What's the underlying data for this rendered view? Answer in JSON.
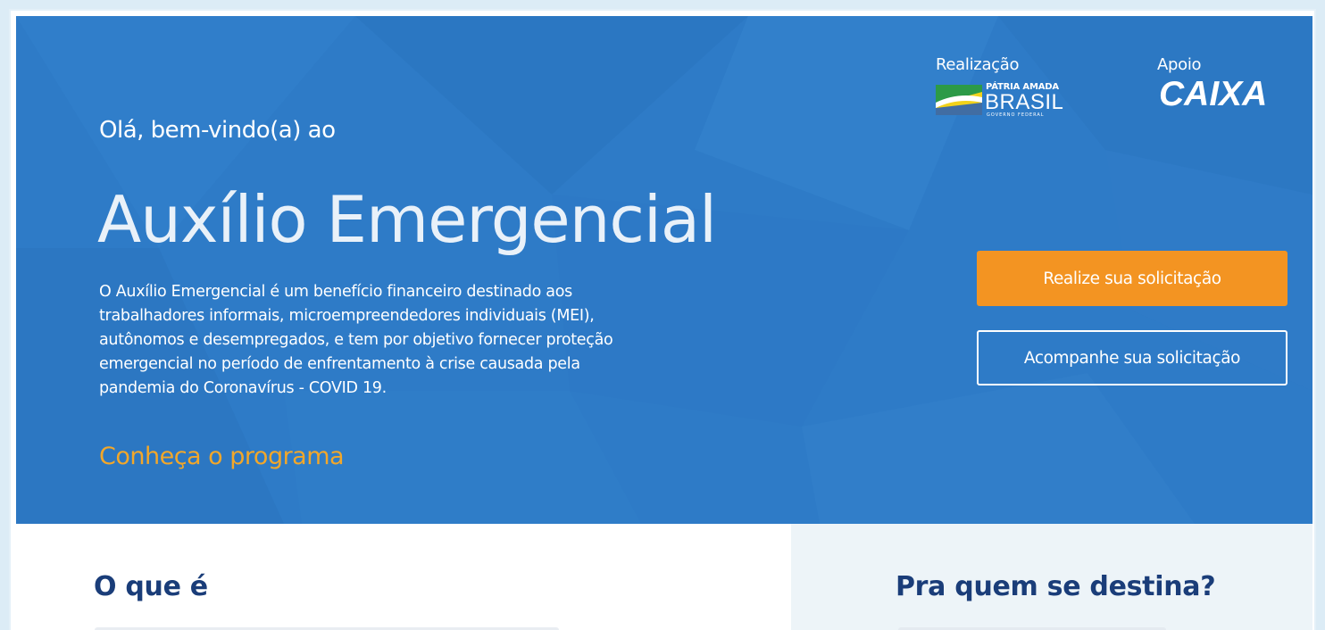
{
  "hero": {
    "greeting": "Olá, bem-vindo(a) ao",
    "title": "Auxílio Emergencial",
    "description": "O Auxílio Emergencial é um benefício financeiro destinado aos trabalhadores informais, microempreendedores individuais (MEI), autônomos e desempregados, e tem por objetivo fornecer proteção emergencial no período de enfrentamento à crise causada pela pandemia do Coronavírus - COVID 19.",
    "know_link": "Conheça o programa"
  },
  "partners": {
    "realizacao_label": "Realização",
    "brasil_small": "PÁTRIA AMADA",
    "brasil_big": "BRASIL",
    "brasil_tiny": "GOVERNO FEDERAL",
    "apoio_label": "Apoio",
    "caixa": "CAIXA"
  },
  "actions": {
    "request_label": "Realize sua solicitação",
    "track_label": "Acompanhe sua solicitação"
  },
  "sections": {
    "what_is_title": "O que é",
    "who_for_title": "Pra quem se destina?"
  },
  "colors": {
    "hero_bg": "#2e7bc7",
    "accent_orange": "#f39422",
    "link_orange": "#f2a72a",
    "heading_navy": "#1a3d79"
  }
}
